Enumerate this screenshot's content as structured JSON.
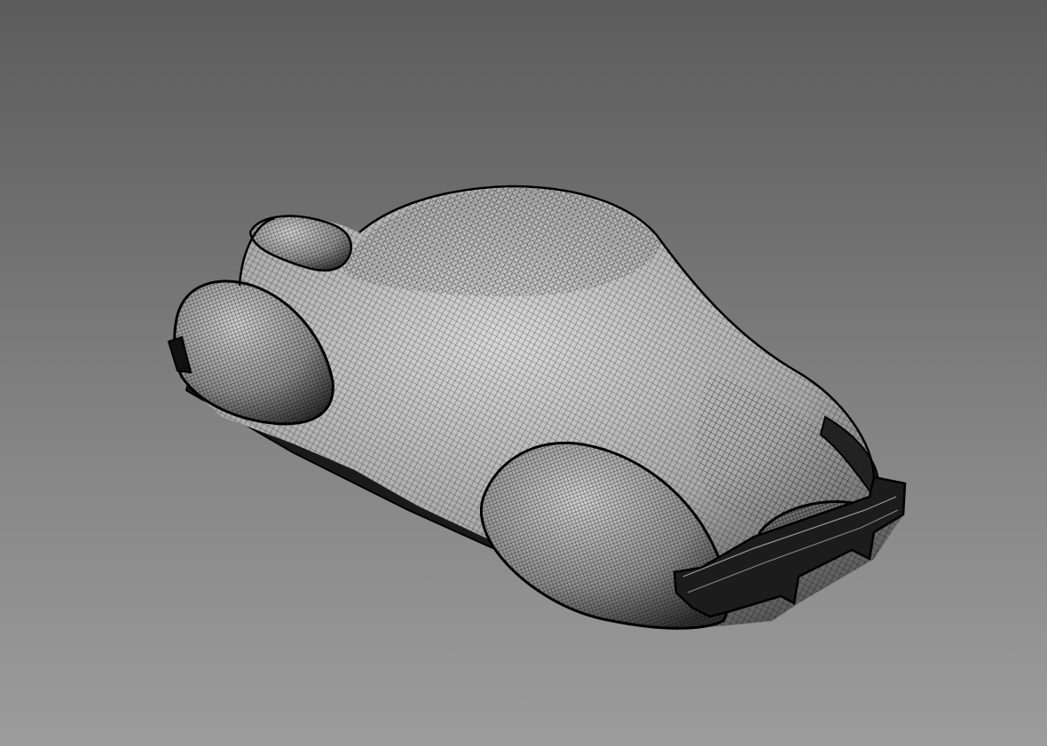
{
  "viewport": {
    "display_mode": "wireframe",
    "background_top": "#5c5c5c",
    "background_bottom": "#9c9c9c",
    "wire_color": "#000000",
    "surface_color": "#bdbdbd"
  },
  "model": {
    "kind": "vintage coupe car body mesh",
    "parts": [
      "body",
      "roof",
      "hood",
      "rear-fender-left",
      "front-fender-right",
      "running-board",
      "front-bumper",
      "rear-bumper",
      "grille"
    ]
  }
}
